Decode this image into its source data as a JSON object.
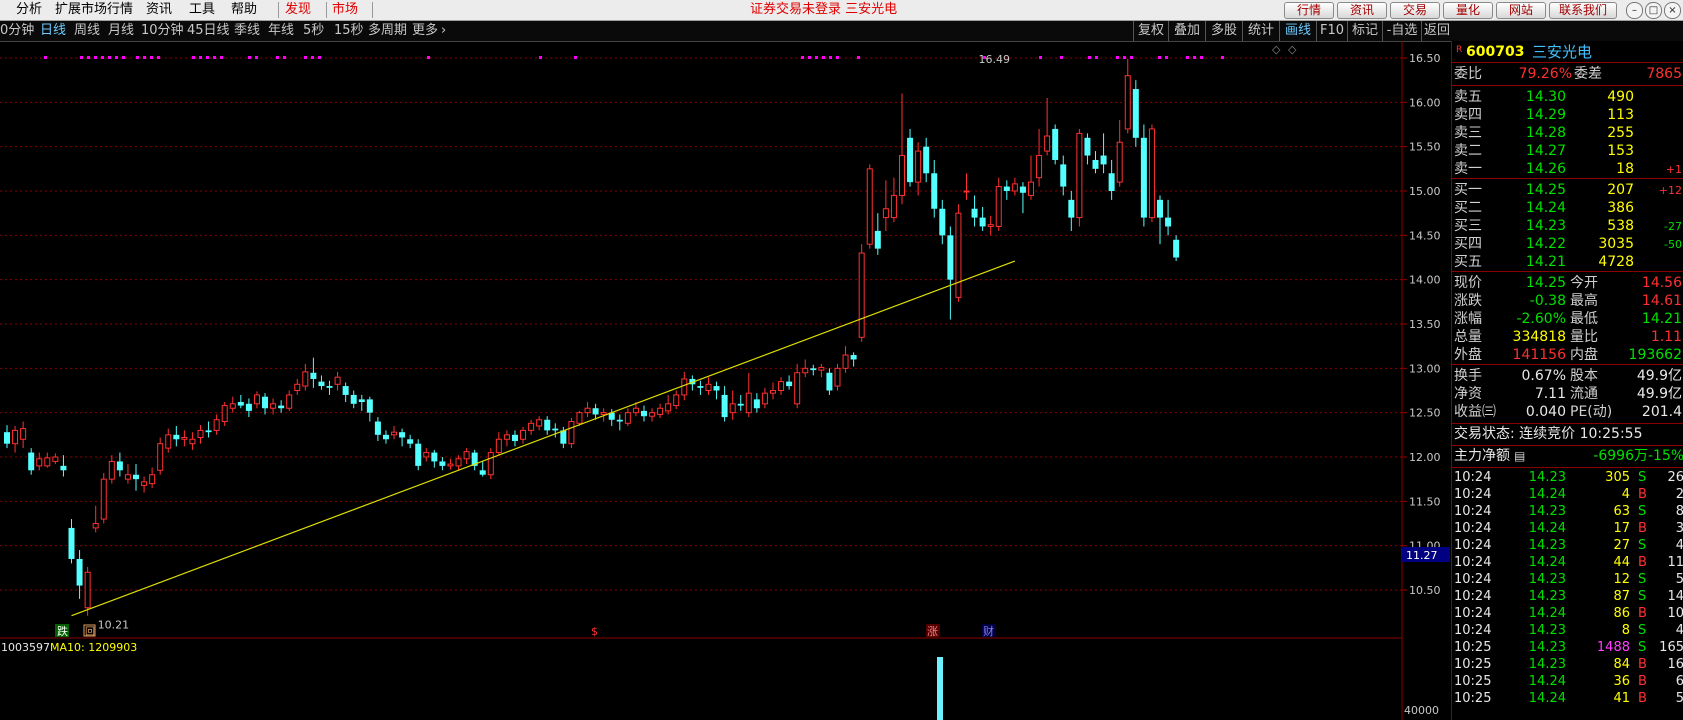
{
  "menu": {
    "items": [
      "分析",
      "扩展市场行情",
      "资讯",
      "工具",
      "帮助"
    ],
    "red_items": [
      "发现",
      "市场"
    ],
    "notice": "证券交易未登录  三安光电",
    "right_buttons": [
      "行情",
      "资讯",
      "交易",
      "量化",
      "网站",
      "联系我们"
    ]
  },
  "periods": {
    "items": [
      "0分钟",
      "日线",
      "周线",
      "月线",
      "10分钟",
      "45日线",
      "季线",
      "年线",
      "5秒",
      "15秒",
      "多周期",
      "更多"
    ],
    "active": "日线",
    "tools": [
      "复权",
      "叠加",
      "多股",
      "统计",
      "画线",
      "F10",
      "标记",
      "-自选",
      "返回"
    ],
    "active_tool": "画线"
  },
  "stock": {
    "code": "600703",
    "name": "三安光电",
    "r_badge": "R"
  },
  "chart_data": {
    "type": "candlestick",
    "y_ticks": [
      "16.50",
      "16.00",
      "15.50",
      "15.00",
      "14.50",
      "14.00",
      "13.50",
      "13.00",
      "12.50",
      "12.00",
      "11.50",
      "11.00",
      "10.50"
    ],
    "ylim": [
      10.25,
      16.7
    ],
    "current_price_marker": "11.27",
    "high_label": "16.49",
    "low_label": "10.21",
    "trendline": {
      "from_index": 8,
      "from_price": 10.21,
      "to_index": 125,
      "to_price": 14.21
    },
    "candles": [
      [
        12.28,
        12.15,
        12.36,
        12.1
      ],
      [
        12.15,
        12.3,
        12.35,
        12.05
      ],
      [
        12.2,
        12.32,
        12.4,
        12.1
      ],
      [
        12.05,
        11.85,
        12.1,
        11.8
      ],
      [
        11.9,
        11.98,
        12.05,
        11.85
      ],
      [
        11.9,
        11.99,
        12.05,
        11.88
      ],
      [
        11.95,
        12.0,
        12.04,
        11.92
      ],
      [
        11.9,
        11.85,
        12.02,
        11.78
      ],
      [
        11.2,
        10.85,
        11.3,
        10.8
      ],
      [
        10.85,
        10.55,
        10.95,
        10.4
      ],
      [
        10.3,
        10.7,
        10.76,
        10.21
      ],
      [
        11.2,
        11.25,
        11.45,
        11.15
      ],
      [
        11.3,
        11.75,
        11.82,
        11.25
      ],
      [
        11.75,
        11.95,
        12.02,
        11.7
      ],
      [
        11.95,
        11.85,
        12.05,
        11.78
      ],
      [
        11.75,
        11.8,
        11.92,
        11.7
      ],
      [
        11.8,
        11.75,
        11.92,
        11.62
      ],
      [
        11.68,
        11.72,
        11.78,
        11.6
      ],
      [
        11.7,
        11.8,
        11.88,
        11.65
      ],
      [
        11.85,
        12.15,
        12.22,
        11.8
      ],
      [
        12.1,
        12.25,
        12.32,
        12.05
      ],
      [
        12.25,
        12.2,
        12.35,
        12.12
      ],
      [
        12.2,
        12.22,
        12.3,
        12.12
      ],
      [
        12.15,
        12.2,
        12.28,
        12.08
      ],
      [
        12.22,
        12.3,
        12.36,
        12.15
      ],
      [
        12.3,
        12.28,
        12.4,
        12.22
      ],
      [
        12.3,
        12.42,
        12.48,
        12.25
      ],
      [
        12.4,
        12.58,
        12.62,
        12.35
      ],
      [
        12.55,
        12.6,
        12.68,
        12.5
      ],
      [
        12.62,
        12.58,
        12.7,
        12.55
      ],
      [
        12.6,
        12.52,
        12.66,
        12.45
      ],
      [
        12.6,
        12.7,
        12.74,
        12.55
      ],
      [
        12.68,
        12.55,
        12.72,
        12.48
      ],
      [
        12.55,
        12.6,
        12.66,
        12.48
      ],
      [
        12.58,
        12.55,
        12.64,
        12.5
      ],
      [
        12.55,
        12.7,
        12.75,
        12.52
      ],
      [
        12.75,
        12.82,
        12.88,
        12.7
      ],
      [
        12.8,
        12.96,
        13.05,
        12.75
      ],
      [
        12.95,
        12.88,
        13.12,
        12.78
      ],
      [
        12.85,
        12.8,
        12.92,
        12.76
      ],
      [
        12.8,
        12.78,
        12.86,
        12.7
      ],
      [
        12.82,
        12.9,
        12.96,
        12.75
      ],
      [
        12.8,
        12.7,
        12.84,
        12.62
      ],
      [
        12.7,
        12.6,
        12.75,
        12.55
      ],
      [
        12.65,
        12.62,
        12.7,
        12.52
      ],
      [
        12.65,
        12.5,
        12.68,
        12.4
      ],
      [
        12.4,
        12.25,
        12.45,
        12.18
      ],
      [
        12.25,
        12.2,
        12.3,
        12.15
      ],
      [
        12.25,
        12.28,
        12.35,
        12.2
      ],
      [
        12.28,
        12.22,
        12.32,
        12.12
      ],
      [
        12.2,
        12.15,
        12.25,
        12.1
      ],
      [
        12.15,
        11.9,
        12.2,
        11.85
      ],
      [
        12.0,
        12.05,
        12.1,
        11.95
      ],
      [
        12.05,
        11.95,
        12.08,
        11.88
      ],
      [
        11.95,
        11.9,
        12.0,
        11.85
      ],
      [
        11.9,
        11.92,
        11.98,
        11.86
      ],
      [
        11.9,
        11.98,
        12.02,
        11.85
      ],
      [
        11.98,
        12.06,
        12.1,
        11.92
      ],
      [
        12.05,
        11.9,
        12.08,
        11.85
      ],
      [
        11.85,
        11.8,
        11.95,
        11.78
      ],
      [
        11.8,
        12.05,
        12.1,
        11.75
      ],
      [
        12.05,
        12.2,
        12.28,
        12.02
      ],
      [
        12.2,
        12.25,
        12.3,
        12.12
      ],
      [
        12.25,
        12.18,
        12.3,
        12.12
      ],
      [
        12.2,
        12.3,
        12.34,
        12.15
      ],
      [
        12.3,
        12.38,
        12.42,
        12.25
      ],
      [
        12.35,
        12.42,
        12.46,
        12.3
      ],
      [
        12.42,
        12.3,
        12.46,
        12.25
      ],
      [
        12.32,
        12.3,
        12.38,
        12.22
      ],
      [
        12.3,
        12.15,
        12.34,
        12.1
      ],
      [
        12.15,
        12.4,
        12.44,
        12.1
      ],
      [
        12.38,
        12.5,
        12.52,
        12.35
      ],
      [
        12.5,
        12.55,
        12.62,
        12.45
      ],
      [
        12.55,
        12.48,
        12.6,
        12.42
      ],
      [
        12.48,
        12.5,
        12.55,
        12.4
      ],
      [
        12.5,
        12.42,
        12.54,
        12.35
      ],
      [
        12.42,
        12.4,
        12.48,
        12.3
      ],
      [
        12.38,
        12.5,
        12.55,
        12.35
      ],
      [
        12.5,
        12.55,
        12.62,
        12.46
      ],
      [
        12.52,
        12.46,
        12.58,
        12.4
      ],
      [
        12.46,
        12.5,
        12.55,
        12.4
      ],
      [
        12.48,
        12.55,
        12.6,
        12.44
      ],
      [
        12.52,
        12.6,
        12.7,
        12.48
      ],
      [
        12.58,
        12.7,
        12.75,
        12.54
      ],
      [
        12.7,
        12.88,
        12.96,
        12.64
      ],
      [
        12.88,
        12.82,
        12.92,
        12.75
      ],
      [
        12.8,
        12.78,
        12.86,
        12.7
      ],
      [
        12.75,
        12.82,
        12.9,
        12.7
      ],
      [
        12.8,
        12.75,
        12.85,
        12.65
      ],
      [
        12.7,
        12.45,
        12.8,
        12.4
      ],
      [
        12.5,
        12.6,
        12.75,
        12.42
      ],
      [
        12.6,
        12.58,
        12.7,
        12.52
      ],
      [
        12.5,
        12.72,
        12.95,
        12.45
      ],
      [
        12.65,
        12.55,
        12.72,
        12.5
      ],
      [
        12.6,
        12.72,
        12.78,
        12.55
      ],
      [
        12.72,
        12.75,
        12.84,
        12.65
      ],
      [
        12.75,
        12.85,
        12.9,
        12.7
      ],
      [
        12.85,
        12.8,
        12.92,
        12.76
      ],
      [
        12.6,
        12.95,
        13.05,
        12.55
      ],
      [
        12.95,
        13.0,
        13.1,
        12.9
      ],
      [
        13.0,
        12.98,
        13.04,
        12.92
      ],
      [
        12.98,
        13.01,
        13.05,
        12.9
      ],
      [
        12.95,
        12.75,
        13.0,
        12.7
      ],
      [
        12.8,
        13.0,
        13.05,
        12.75
      ],
      [
        13.0,
        13.15,
        13.25,
        12.95
      ],
      [
        13.15,
        13.1,
        13.18,
        13.02
      ],
      [
        13.35,
        14.3,
        14.4,
        13.3
      ],
      [
        14.4,
        15.25,
        15.3,
        14.35
      ],
      [
        14.55,
        14.35,
        14.75,
        14.28
      ],
      [
        14.7,
        14.8,
        15.12,
        14.55
      ],
      [
        14.7,
        14.95,
        15.15,
        14.65
      ],
      [
        14.95,
        15.4,
        16.1,
        14.85
      ],
      [
        15.6,
        15.1,
        15.7,
        15.05
      ],
      [
        15.1,
        15.45,
        15.55,
        14.95
      ],
      [
        15.5,
        15.2,
        15.6,
        15.1
      ],
      [
        15.2,
        14.8,
        15.35,
        14.7
      ],
      [
        14.8,
        14.5,
        14.9,
        14.4
      ],
      [
        14.5,
        14.0,
        14.6,
        13.55
      ],
      [
        13.8,
        14.75,
        14.85,
        13.75
      ],
      [
        15.0,
        15.0,
        15.2,
        14.9
      ],
      [
        14.8,
        14.7,
        14.95,
        14.6
      ],
      [
        14.7,
        14.6,
        14.82,
        14.55
      ],
      [
        14.6,
        14.62,
        14.72,
        14.5
      ],
      [
        14.6,
        15.05,
        15.15,
        14.55
      ],
      [
        15.05,
        15.0,
        15.12,
        14.9
      ],
      [
        15.0,
        15.08,
        15.15,
        14.95
      ],
      [
        15.05,
        14.98,
        15.1,
        14.75
      ],
      [
        14.95,
        15.1,
        15.4,
        14.9
      ],
      [
        15.15,
        15.4,
        15.7,
        15.05
      ],
      [
        15.45,
        15.62,
        16.05,
        15.4
      ],
      [
        15.7,
        15.35,
        15.75,
        15.3
      ],
      [
        15.3,
        15.05,
        15.4,
        14.95
      ],
      [
        14.9,
        14.7,
        15.0,
        14.55
      ],
      [
        14.7,
        15.65,
        15.7,
        14.6
      ],
      [
        15.6,
        15.4,
        15.65,
        15.3
      ],
      [
        15.35,
        15.25,
        15.45,
        15.2
      ],
      [
        15.4,
        15.3,
        15.65,
        15.2
      ],
      [
        15.2,
        15.0,
        15.35,
        14.9
      ],
      [
        15.1,
        15.55,
        15.8,
        15.05
      ],
      [
        15.7,
        16.3,
        16.49,
        15.65
      ],
      [
        16.15,
        15.6,
        16.25,
        15.5
      ],
      [
        15.6,
        14.7,
        15.75,
        14.6
      ],
      [
        14.7,
        15.7,
        15.75,
        14.65
      ],
      [
        14.9,
        14.7,
        14.95,
        14.4
      ],
      [
        14.7,
        14.6,
        14.9,
        14.5
      ],
      [
        14.45,
        14.25,
        14.5,
        14.21
      ]
    ]
  },
  "volume": {
    "label_total": "1003597",
    "label_ma": "MA10: 1209903",
    "axis_label": "40000"
  },
  "markers": {
    "die": "跌",
    "hui": "回",
    "s": "$",
    "zhang": "涨",
    "cai": "财"
  },
  "quote": {
    "weibi_label": "委比",
    "weibi": "79.26%",
    "weicha_label": "委差",
    "weicha": "7865",
    "asks": [
      {
        "label": "卖五",
        "price": "14.30",
        "vol": "490",
        "chg": ""
      },
      {
        "label": "卖四",
        "price": "14.29",
        "vol": "113",
        "chg": ""
      },
      {
        "label": "卖三",
        "price": "14.28",
        "vol": "255",
        "chg": ""
      },
      {
        "label": "卖二",
        "price": "14.27",
        "vol": "153",
        "chg": ""
      },
      {
        "label": "卖一",
        "price": "14.26",
        "vol": "18",
        "chg": "+1"
      }
    ],
    "bids": [
      {
        "label": "买一",
        "price": "14.25",
        "vol": "207",
        "chg": "+12"
      },
      {
        "label": "买二",
        "price": "14.24",
        "vol": "386",
        "chg": ""
      },
      {
        "label": "买三",
        "price": "14.23",
        "vol": "538",
        "chg": "-27"
      },
      {
        "label": "买四",
        "price": "14.22",
        "vol": "3035",
        "chg": "-50"
      },
      {
        "label": "买五",
        "price": "14.21",
        "vol": "4728",
        "chg": ""
      }
    ],
    "stats": [
      {
        "l1": "现价",
        "v1": "14.25",
        "l2": "今开",
        "v2": "14.56"
      },
      {
        "l1": "涨跌",
        "v1": "-0.38",
        "l2": "最高",
        "v2": "14.61"
      },
      {
        "l1": "涨幅",
        "v1": "-2.60%",
        "l2": "最低",
        "v2": "14.21"
      },
      {
        "l1": "总量",
        "v1": "334818",
        "l2": "量比",
        "v2": "1.11"
      },
      {
        "l1": "外盘",
        "v1": "141156",
        "l2": "内盘",
        "v2": "193662"
      }
    ],
    "stats2": [
      {
        "l1": "换手",
        "v1": "0.67%",
        "l2": "股本",
        "v2": "49.9亿"
      },
      {
        "l1": "净资",
        "v1": "7.11",
        "l2": "流通",
        "v2": "49.9亿"
      },
      {
        "l1": "收益㈢",
        "v1": "0.040",
        "l2": "PE(动)",
        "v2": "201.4"
      }
    ],
    "trade_status": "交易状态: 连续竞价 10:25:55",
    "main_net_label": "主力净额",
    "main_net": "-6996万",
    "main_net_pct": "-15%"
  },
  "ticks": [
    {
      "t": "10:24",
      "p": "14.23",
      "v": "305",
      "d": "S",
      "n": "26"
    },
    {
      "t": "10:24",
      "p": "14.24",
      "v": "4",
      "d": "B",
      "n": "2"
    },
    {
      "t": "10:24",
      "p": "14.23",
      "v": "63",
      "d": "S",
      "n": "8"
    },
    {
      "t": "10:24",
      "p": "14.24",
      "v": "17",
      "d": "B",
      "n": "3"
    },
    {
      "t": "10:24",
      "p": "14.23",
      "v": "27",
      "d": "S",
      "n": "4"
    },
    {
      "t": "10:24",
      "p": "14.24",
      "v": "44",
      "d": "B",
      "n": "11"
    },
    {
      "t": "10:24",
      "p": "14.23",
      "v": "12",
      "d": "S",
      "n": "5"
    },
    {
      "t": "10:24",
      "p": "14.23",
      "v": "87",
      "d": "S",
      "n": "14"
    },
    {
      "t": "10:24",
      "p": "14.24",
      "v": "86",
      "d": "B",
      "n": "10"
    },
    {
      "t": "10:24",
      "p": "14.23",
      "v": "8",
      "d": "S",
      "n": "4"
    },
    {
      "t": "10:25",
      "p": "14.23",
      "v": "1488",
      "d": "S",
      "n": "165"
    },
    {
      "t": "10:25",
      "p": "14.23",
      "v": "84",
      "d": "B",
      "n": "16"
    },
    {
      "t": "10:25",
      "p": "14.24",
      "v": "36",
      "d": "B",
      "n": "6"
    },
    {
      "t": "10:25",
      "p": "14.24",
      "v": "41",
      "d": "B",
      "n": "5"
    }
  ]
}
